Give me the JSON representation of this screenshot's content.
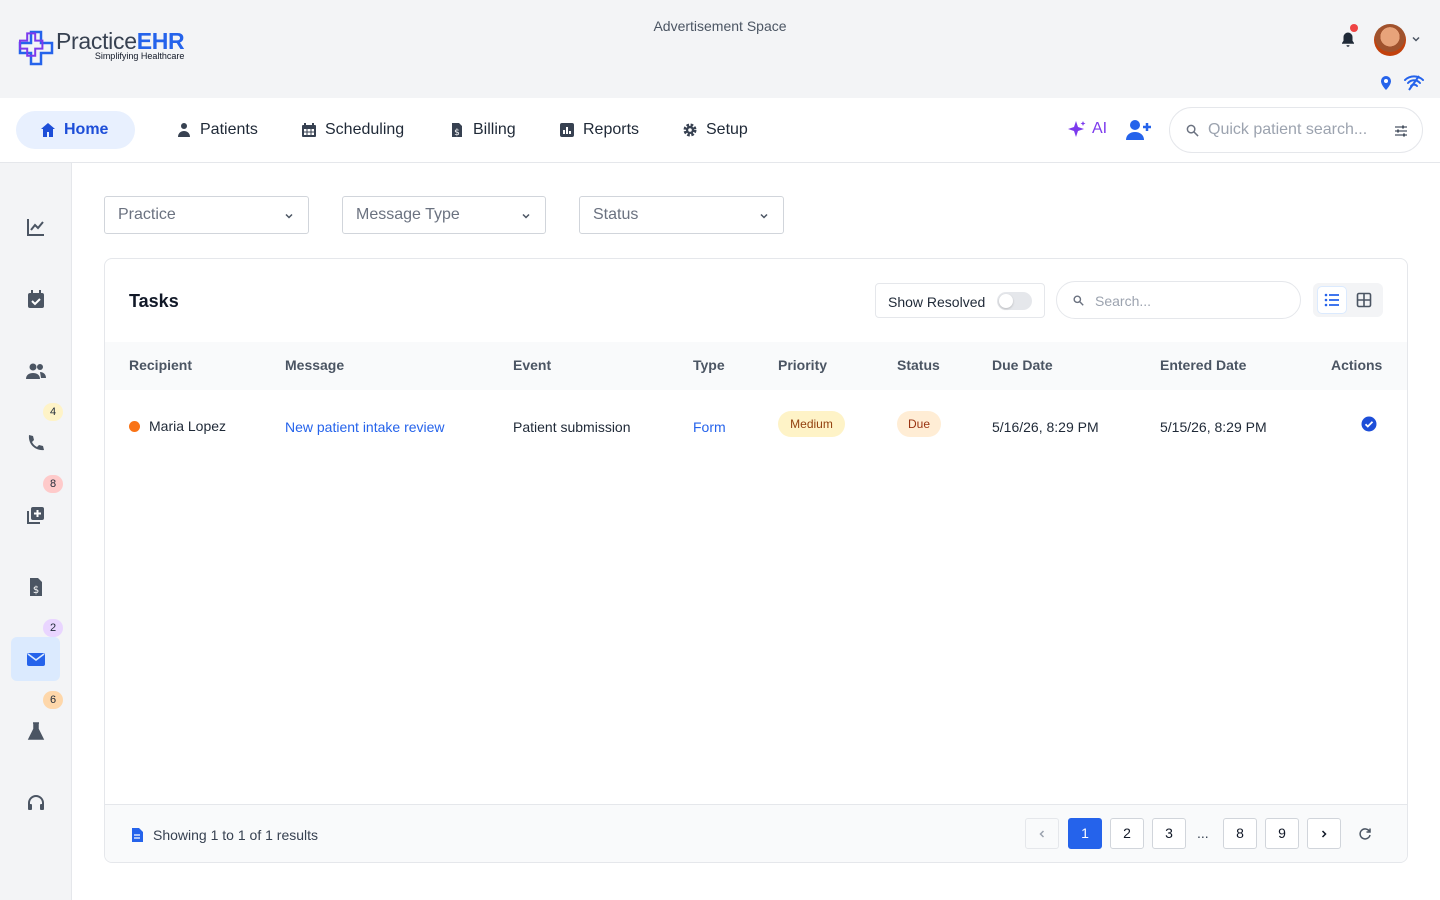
{
  "brand": {
    "name_part1": "Practice",
    "name_part2": "EHR",
    "tagline": "Simplifying Healthcare"
  },
  "ad_space": "Advertisement Space",
  "header": {
    "icons": [
      "bell-icon",
      "avatar",
      "chevron-down-icon",
      "location-pin-icon",
      "wifi-icon"
    ]
  },
  "nav": {
    "items": [
      {
        "label": "Home",
        "icon": "home-icon",
        "active": true
      },
      {
        "label": "Patients",
        "icon": "patient-icon"
      },
      {
        "label": "Scheduling",
        "icon": "calendar-icon"
      },
      {
        "label": "Billing",
        "icon": "invoice-icon"
      },
      {
        "label": "Reports",
        "icon": "chart-icon"
      },
      {
        "label": "Setup",
        "icon": "gear-icon"
      }
    ],
    "ai_label": "AI",
    "quick_search_placeholder": "Quick patient search..."
  },
  "sidebar": {
    "items": [
      {
        "icon": "analytics-icon",
        "badge": ""
      },
      {
        "icon": "calendar-check-icon",
        "badge": ""
      },
      {
        "icon": "users-icon",
        "badge": ""
      },
      {
        "icon": "phone-icon",
        "badge": "4"
      },
      {
        "icon": "add-document-icon",
        "badge": "8"
      },
      {
        "icon": "invoice-icon",
        "badge": ""
      },
      {
        "icon": "mail-icon",
        "badge": "2",
        "active": true
      },
      {
        "icon": "lab-flask-icon",
        "badge": "6"
      },
      {
        "icon": "headset-icon",
        "badge": ""
      }
    ]
  },
  "filters": {
    "practice": "Practice",
    "message_type": "Message Type",
    "status": "Status"
  },
  "tasks": {
    "title": "Tasks",
    "show_resolved_label": "Show Resolved",
    "show_resolved": false,
    "search_placeholder": "Search...",
    "columns": [
      "Recipient",
      "Message",
      "Event",
      "Type",
      "Priority",
      "Status",
      "Due Date",
      "Entered Date",
      "Actions"
    ],
    "rows": [
      {
        "recipient": "Maria Lopez",
        "message": "New patient intake review",
        "event": "Patient submission",
        "type": "Form",
        "priority": "Medium",
        "status": "Due",
        "due_date": "5/16/26, 8:29 PM",
        "entered_date": "5/15/26, 8:29 PM"
      }
    ]
  },
  "footer": {
    "showing_prefix": "Showing ",
    "from": "1",
    "to_word": " to ",
    "to": "1",
    "of_word": " of ",
    "total": "1",
    "suffix": " results",
    "pages": [
      "1",
      "2",
      "3",
      "8",
      "9"
    ],
    "ellipsis": "...",
    "current_page": "1"
  },
  "colors": {
    "accent": "#2563eb",
    "ai": "#7c3aed",
    "status_dot": "#f97316"
  }
}
